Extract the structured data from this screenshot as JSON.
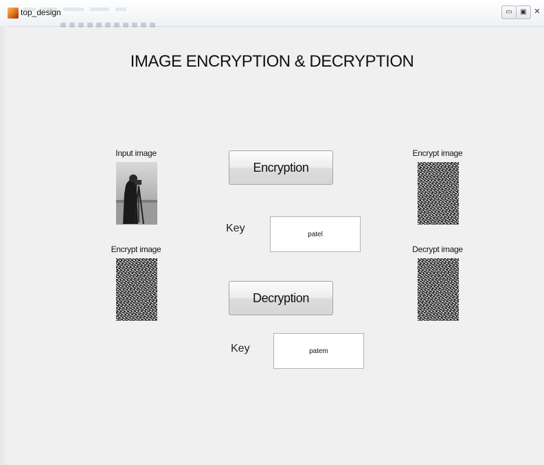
{
  "window": {
    "title": "top_design",
    "controls": {
      "minimize_icon": "minimize-icon",
      "restore_icon": "restore-icon",
      "close_icon": "close-icon"
    }
  },
  "heading": "IMAGE ENCRYPTION & DECRYPTION",
  "left_panel": {
    "input_label": "Input image",
    "encrypt_label": "Encrypt image"
  },
  "right_panel": {
    "encrypt_label": "Encrypt image",
    "decrypt_label": "Decrypt image"
  },
  "encryption": {
    "button_label": "Encryption",
    "key_label": "Key",
    "key_value": "patel"
  },
  "decryption": {
    "button_label": "Decryption",
    "key_label": "Key",
    "key_value": "patem"
  }
}
